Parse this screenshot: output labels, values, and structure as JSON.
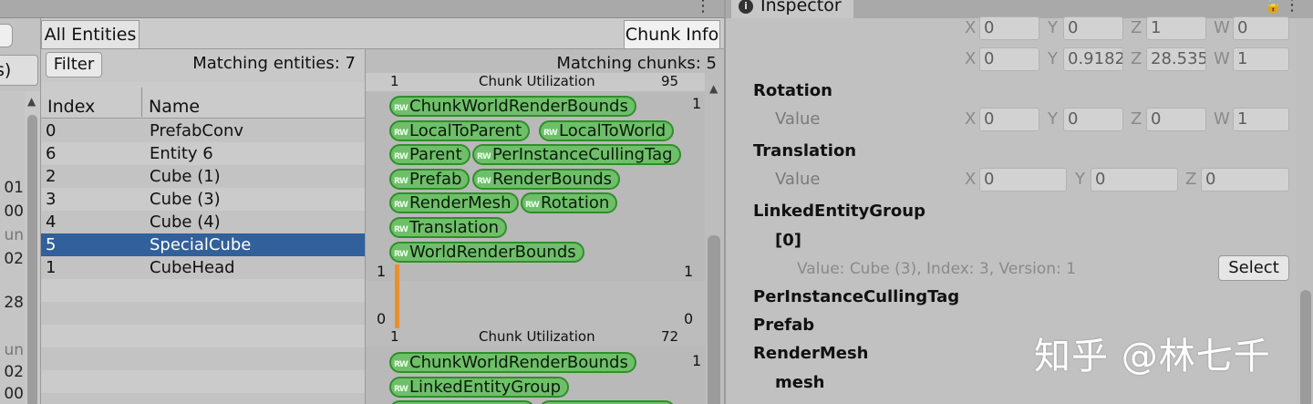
{
  "left_column": {
    "button_text": "s)",
    "clipped_values": [
      "01",
      "00",
      "un",
      "02",
      "28",
      "un",
      "02",
      "00"
    ]
  },
  "toolbar": {
    "all_entities_label": "All Entities",
    "chunk_info_label": "Chunk Info"
  },
  "entity_list": {
    "filter_label": "Filter",
    "matching_text": "Matching entities: 7",
    "columns": [
      "Index",
      "Name"
    ],
    "rows": [
      {
        "index": "0",
        "name": "PrefabConv"
      },
      {
        "index": "6",
        "name": "Entity 6"
      },
      {
        "index": "2",
        "name": "Cube (1)"
      },
      {
        "index": "3",
        "name": "Cube (3)"
      },
      {
        "index": "4",
        "name": "Cube (4)"
      },
      {
        "index": "5",
        "name": "SpecialCube"
      },
      {
        "index": "1",
        "name": "CubeHead"
      }
    ],
    "selected_index": "5"
  },
  "chunk_info": {
    "matching_text": "Matching chunks: 5",
    "chunk1": {
      "util_left": "1",
      "util_label": "Chunk Utilization",
      "util_right": "95",
      "count": "1",
      "components": [
        "ChunkWorldRenderBounds",
        "LocalToParent",
        "LocalToWorld",
        "Parent",
        "PerInstanceCullingTag",
        "Prefab",
        "RenderBounds",
        "RenderMesh",
        "Rotation",
        "Translation",
        "WorldRenderBounds"
      ],
      "histogram": {
        "top_left": "1",
        "top_right": "1",
        "bottom_left": "0",
        "bottom_right": "0",
        "fill": 1.0,
        "bar_color": "#e8902c"
      }
    },
    "chunk2": {
      "util_left": "1",
      "util_label": "Chunk Utilization",
      "util_right": "72",
      "count": "1",
      "components": [
        "ChunkWorldRenderBounds",
        "LinkedEntityGroup"
      ]
    },
    "tag_badge": "RW",
    "tag_color": "#6fbf6a"
  },
  "inspector": {
    "tab_title": "Inspector",
    "row1": {
      "x": "0",
      "y": "0",
      "z": "1",
      "w": "0"
    },
    "row2": {
      "x": "0",
      "y": "0.9182",
      "z": "28.535",
      "w": "1"
    },
    "rotation": {
      "title": "Rotation",
      "label": "Value",
      "x": "0",
      "y": "0",
      "z": "0",
      "w": "1"
    },
    "translation": {
      "title": "Translation",
      "label": "Value",
      "x": "0",
      "y": "0",
      "z": "0"
    },
    "linked_entity_group": {
      "title": "LinkedEntityGroup",
      "element": "[0]",
      "value_text": "Value: Cube (3), Index: 3, Version: 1",
      "select_label": "Select"
    },
    "sections": [
      "PerInstanceCullingTag",
      "Prefab",
      "RenderMesh"
    ],
    "mesh_label": "mesh",
    "axis_labels": {
      "x": "X",
      "y": "Y",
      "z": "Z",
      "w": "W"
    }
  },
  "watermark": "知乎 @林七千"
}
